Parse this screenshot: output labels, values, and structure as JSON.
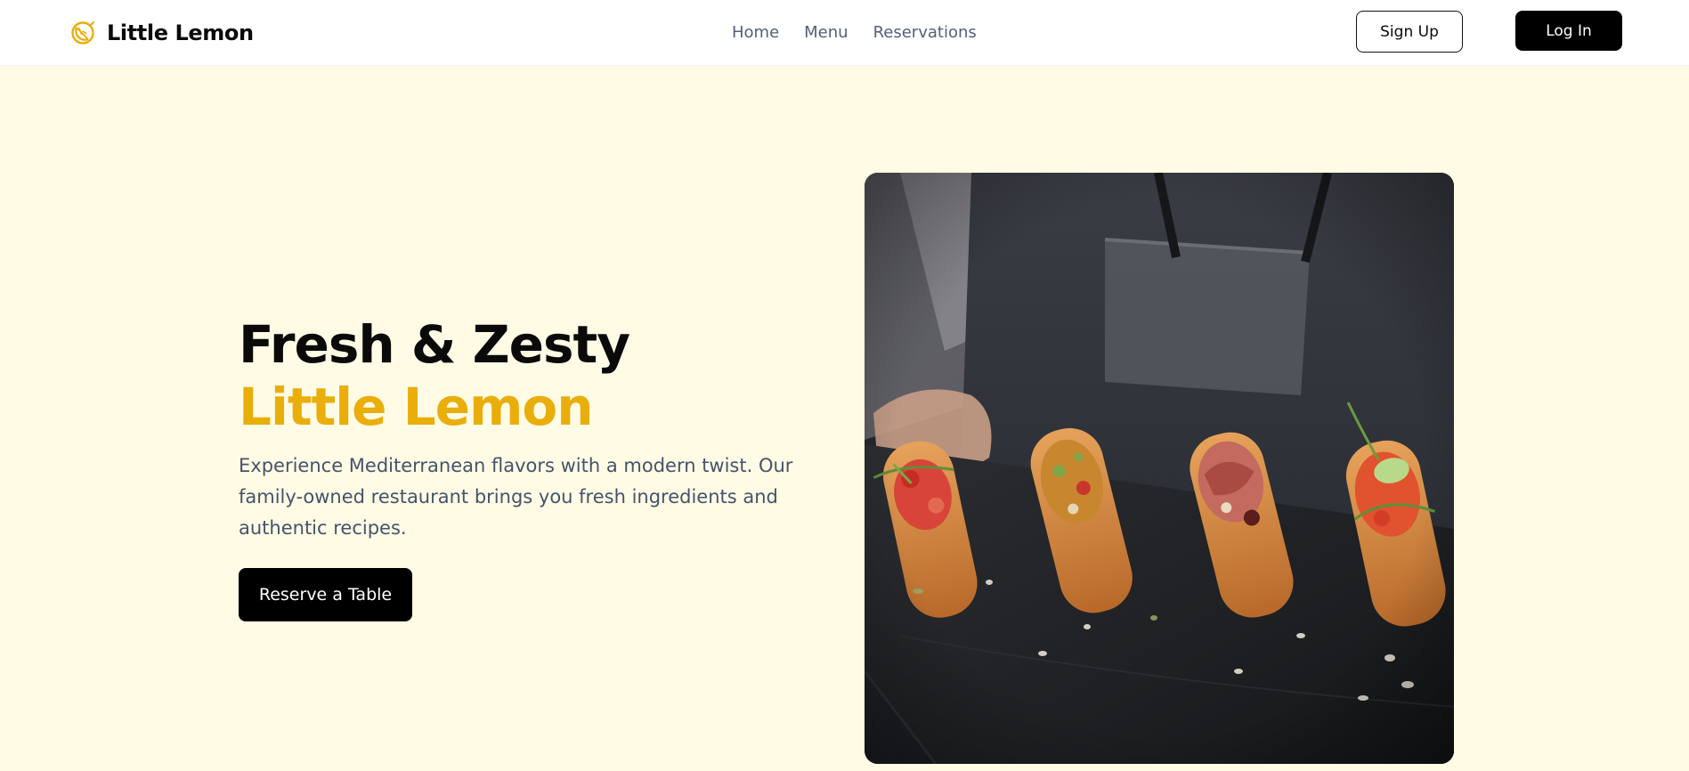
{
  "header": {
    "brand": {
      "name": "Little Lemon",
      "icon": "lemon-icon",
      "icon_color": "#eaae0a"
    },
    "nav": [
      {
        "label": "Home"
      },
      {
        "label": "Menu"
      },
      {
        "label": "Reservations"
      }
    ],
    "sign_up_label": "Sign Up",
    "log_in_label": "Log In"
  },
  "hero": {
    "headline_line1": "Fresh & Zesty",
    "headline_line2": "Little Lemon",
    "description": "Experience Mediterranean flavors with a modern twist. Our family-owned restaurant brings you fresh ingredients and authentic recipes.",
    "cta_label": "Reserve a Table",
    "image": {
      "subject": "chef holding slate board with four topped appetizers"
    }
  },
  "colors": {
    "accent": "#eaae0a",
    "hero_background": "#fffbe5",
    "nav_text": "#51607a",
    "body_text": "#45536b",
    "primary_button": "#000000"
  }
}
